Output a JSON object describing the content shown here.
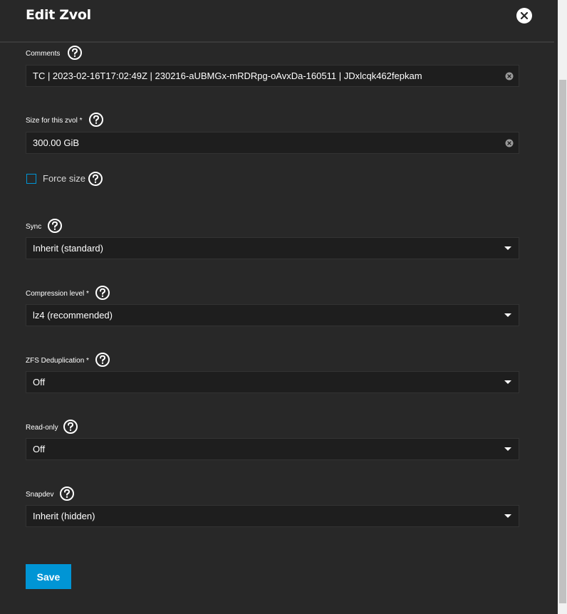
{
  "dialog": {
    "title": "Edit Zvol"
  },
  "fields": {
    "comments": {
      "label": "Comments",
      "value": "TC | 2023-02-16T17:02:49Z | 230216-aUBMGx-mRDRpg-oAvxDa-160511 | JDxlcqk462fepkam"
    },
    "size": {
      "label": "Size for this zvol *",
      "value": "300.00 GiB"
    },
    "force_size": {
      "label": "Force size",
      "checked": false
    },
    "sync": {
      "label": "Sync",
      "value": "Inherit (standard)"
    },
    "compression": {
      "label": "Compression level *",
      "value": "lz4 (recommended)"
    },
    "dedup": {
      "label": "ZFS Deduplication *",
      "value": "Off"
    },
    "readonly": {
      "label": "Read-only",
      "value": "Off"
    },
    "snapdev": {
      "label": "Snapdev",
      "value": "Inherit (hidden)"
    }
  },
  "actions": {
    "save_label": "Save"
  },
  "colors": {
    "background": "#282828",
    "input_background": "#1e1e1e",
    "accent": "#0095d5",
    "text": "#ffffff"
  }
}
